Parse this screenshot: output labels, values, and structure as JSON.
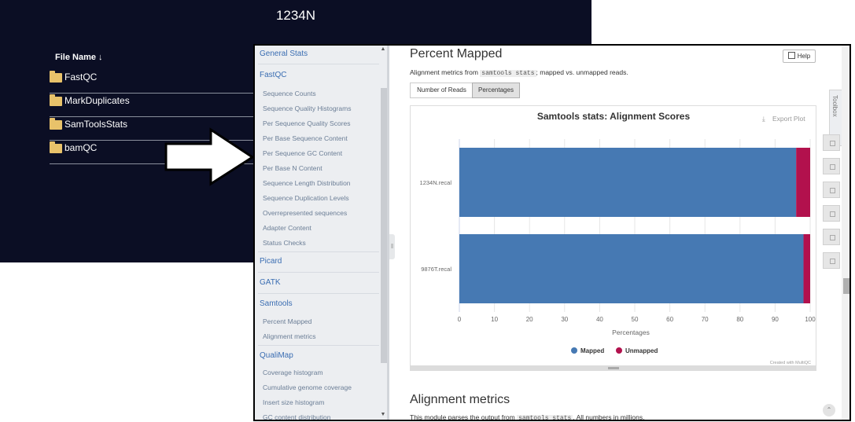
{
  "file_browser": {
    "title": "1234N",
    "column_header": "File Name ↓",
    "folders": [
      "FastQC",
      "MarkDuplicates",
      "SamToolsStats",
      "bamQC"
    ]
  },
  "sidebar": {
    "general": "General Stats",
    "fastqc": "FastQC",
    "fastqc_items": [
      "Sequence Counts",
      "Sequence Quality Histograms",
      "Per Sequence Quality Scores",
      "Per Base Sequence Content",
      "Per Sequence GC Content",
      "Per Base N Content",
      "Sequence Length Distribution",
      "Sequence Duplication Levels",
      "Overrepresented sequences",
      "Adapter Content",
      "Status Checks"
    ],
    "picard": "Picard",
    "gatk": "GATK",
    "samtools": "Samtools",
    "samtools_items": [
      "Percent Mapped",
      "Alignment metrics"
    ],
    "qualimap": "QualiMap",
    "qualimap_items": [
      "Coverage histogram",
      "Cumulative genome coverage",
      "Insert size histogram",
      "GC content distribution"
    ]
  },
  "main": {
    "heading": "Percent Mapped",
    "desc_pre": "Alignment metrics from",
    "desc_code": "samtools stats",
    "desc_post": "; mapped vs. unmapped reads.",
    "help_label": "Help",
    "btn_reads": "Number of Reads",
    "btn_pct": "Percentages",
    "export": "Export Plot",
    "credit": "Created with MultiQC",
    "heading2": "Alignment metrics",
    "desc2_pre": "This module parses the output from",
    "desc2_code": "samtools stats",
    "desc2_post": ". All numbers in millions.",
    "toolbox": "Toolbox"
  },
  "colors": {
    "mapped": "#4679b3",
    "unmapped": "#b2114d",
    "link": "#3a6db2",
    "dark_bg": "#0b0e24"
  },
  "chart_data": {
    "type": "bar",
    "orientation": "horizontal",
    "stacked": true,
    "title": "Samtools stats: Alignment Scores",
    "categories": [
      "1234N.recal",
      "9876T.recal"
    ],
    "series": [
      {
        "name": "Mapped",
        "values": [
          96.0,
          98.1
        ]
      },
      {
        "name": "Unmapped",
        "values": [
          4.0,
          1.9
        ]
      }
    ],
    "xlabel": "Percentages",
    "xlim": [
      0,
      100
    ],
    "xticks": [
      0,
      10,
      20,
      30,
      40,
      50,
      60,
      70,
      80,
      90,
      100
    ],
    "legend": "bottom"
  }
}
